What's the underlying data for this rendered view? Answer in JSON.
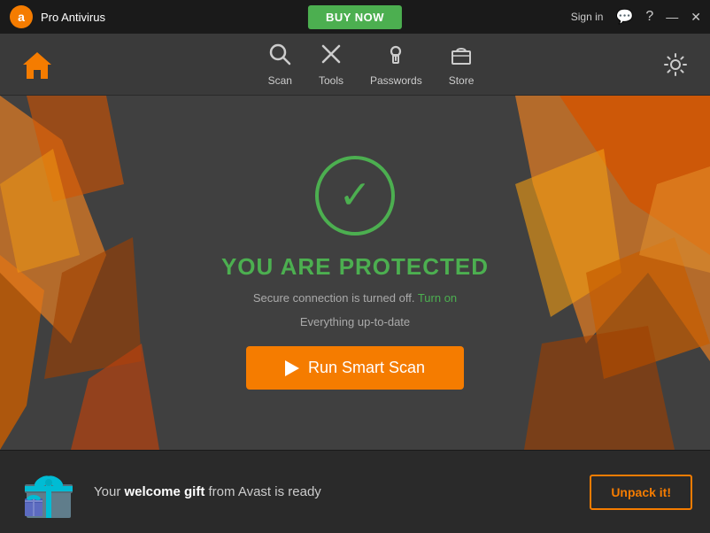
{
  "titlebar": {
    "app_name": "Pro Antivirus",
    "buy_now_label": "BUY NOW",
    "sign_in_label": "Sign in",
    "chat_icon": "💬",
    "help_icon": "?",
    "minimize_icon": "—",
    "close_icon": "✕"
  },
  "navbar": {
    "home_icon": "🏠",
    "items": [
      {
        "id": "scan",
        "label": "Scan",
        "icon": "🔍"
      },
      {
        "id": "tools",
        "label": "Tools",
        "icon": "🔧"
      },
      {
        "id": "passwords",
        "label": "Passwords",
        "icon": "🔑"
      },
      {
        "id": "store",
        "label": "Store",
        "icon": "🛒"
      }
    ],
    "settings_icon": "⚙"
  },
  "main": {
    "check_icon": "✓",
    "protection_text_prefix": "YOU ARE ",
    "protection_text_highlight": "PROTECTED",
    "subtitle1_text": "Secure connection is turned off.",
    "turn_on_label": "Turn on",
    "subtitle2_text": "Everything up-to-date",
    "run_scan_label": "Run Smart Scan"
  },
  "bottom": {
    "gift_text_prefix": "Your ",
    "gift_text_bold": "welcome gift",
    "gift_text_suffix": " from Avast is ready",
    "unpack_label": "Unpack it!"
  }
}
